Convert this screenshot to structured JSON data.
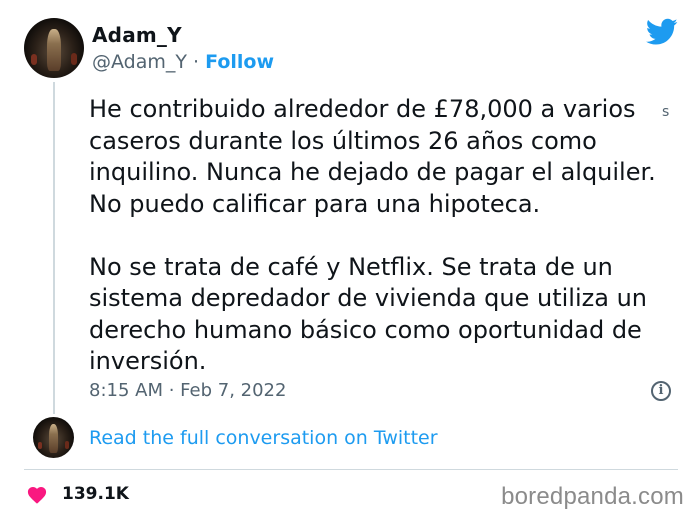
{
  "author": {
    "name": "Adam_Y",
    "handle": "@Adam_Y",
    "separator": "·",
    "follow_label": "Follow"
  },
  "tweet": {
    "paragraphs": [
      "He contribuido alrededor de £78,000 a varios caseros durante los últimos 26 años como inquilino. Nunca he dejado de pagar el alquiler. No puedo calificar para una hipoteca.",
      "No se trata de café y Netflix. Se trata de un sistema depredador de vivienda que utiliza un derecho humano básico como oportunidad de inversión."
    ],
    "side_mark": "s",
    "timestamp": "8:15 AM · Feb 7, 2022"
  },
  "thread": {
    "read_more_label": "Read the full conversation on Twitter"
  },
  "engagement": {
    "likes": "139.1K"
  },
  "watermark": "boredpanda.com",
  "icons": {
    "brand": "twitter-bird-icon",
    "info": "info-icon",
    "like": "heart-icon"
  },
  "colors": {
    "accent": "#1d9bf0",
    "text": "#0f1419",
    "muted": "#536471",
    "heart": "#f91880",
    "divider": "#cfd9de"
  }
}
